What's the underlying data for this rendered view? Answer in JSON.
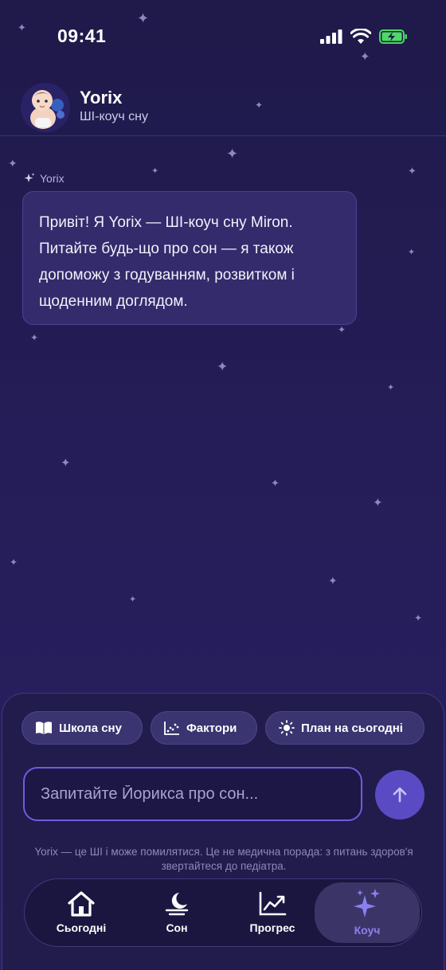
{
  "status_bar": {
    "time": "09:41"
  },
  "header": {
    "title": "Yorix",
    "subtitle": "ШІ-коуч сну",
    "avatar_icon": "baby-avatar-icon"
  },
  "chat": {
    "sender": "Yorix",
    "message": "Привіт! Я Yorix — ШІ-коуч сну Miron. Питайте будь-що про сон — я також допоможу з годуванням, розвитком і щоденним доглядом."
  },
  "quick_actions": [
    {
      "label": "Школа сну",
      "icon": "book-icon"
    },
    {
      "label": "Фактори",
      "icon": "scatter-chart-icon"
    },
    {
      "label": "План на сьогодні",
      "icon": "sun-icon"
    }
  ],
  "composer": {
    "placeholder": "Запитайте Йорикса про сон...",
    "disclaimer": "Yorix — це ШІ і може помилятися. Це не медична порада: з питань здоров'я звертайтеся до педіатра."
  },
  "tabs": [
    {
      "label": "Сьогодні",
      "icon": "home-icon",
      "active": false
    },
    {
      "label": "Сон",
      "icon": "moon-icon",
      "active": false
    },
    {
      "label": "Прогрес",
      "icon": "chart-icon",
      "active": false
    },
    {
      "label": "Коуч",
      "icon": "sparkles-icon",
      "active": true
    }
  ],
  "colors": {
    "background": "#241d57",
    "accent": "#6c5ee0",
    "active_tab": "#8b7ff0",
    "battery": "#4cd964"
  }
}
